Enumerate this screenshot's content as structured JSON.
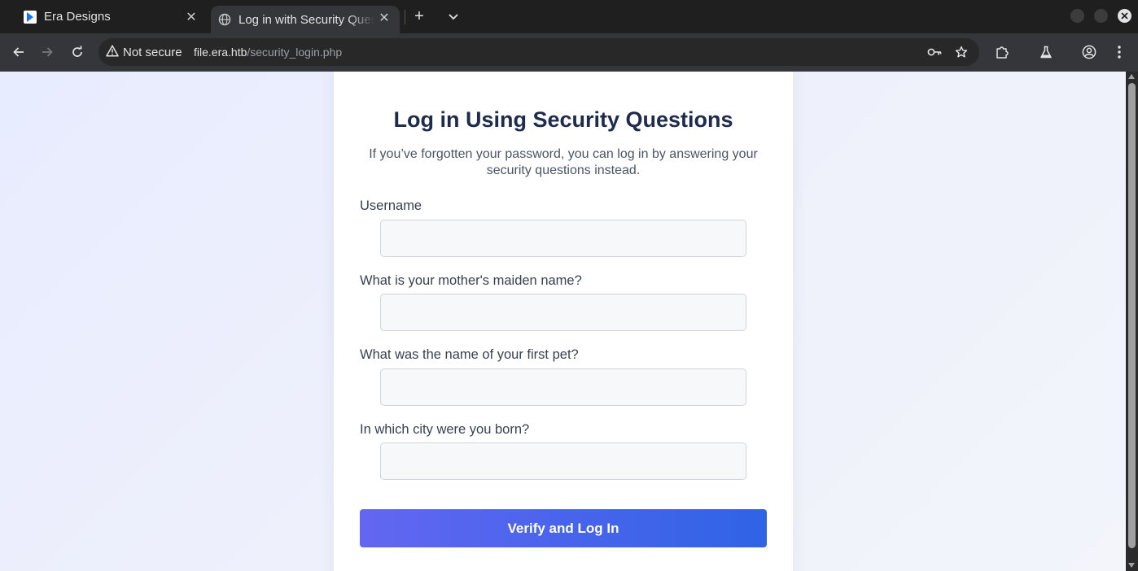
{
  "browser": {
    "tabs": [
      {
        "title": "Era Designs",
        "active": false,
        "favicon": "era-logo-icon"
      },
      {
        "title": "Log in with Security Questions",
        "active": true,
        "favicon": "globe-icon"
      }
    ],
    "security_label": "Not secure",
    "url_host": "file.era.htb",
    "url_path": "/security_login.php"
  },
  "page": {
    "heading": "Log in Using Security Questions",
    "subtext": "If you’ve forgotten your password, you can log in by answering your security questions instead.",
    "fields": [
      {
        "label": "Username",
        "value": "",
        "placeholder": ""
      },
      {
        "label": "What is your mother's maiden name?",
        "value": "",
        "placeholder": ""
      },
      {
        "label": "What was the name of your first pet?",
        "value": "",
        "placeholder": ""
      },
      {
        "label": "In which city were you born?",
        "value": "",
        "placeholder": ""
      }
    ],
    "submit_label": "Verify and Log In"
  },
  "colors": {
    "button_gradient_start": "#6366f1",
    "button_gradient_end": "#2f63e6",
    "heading": "#1e2b4d"
  }
}
